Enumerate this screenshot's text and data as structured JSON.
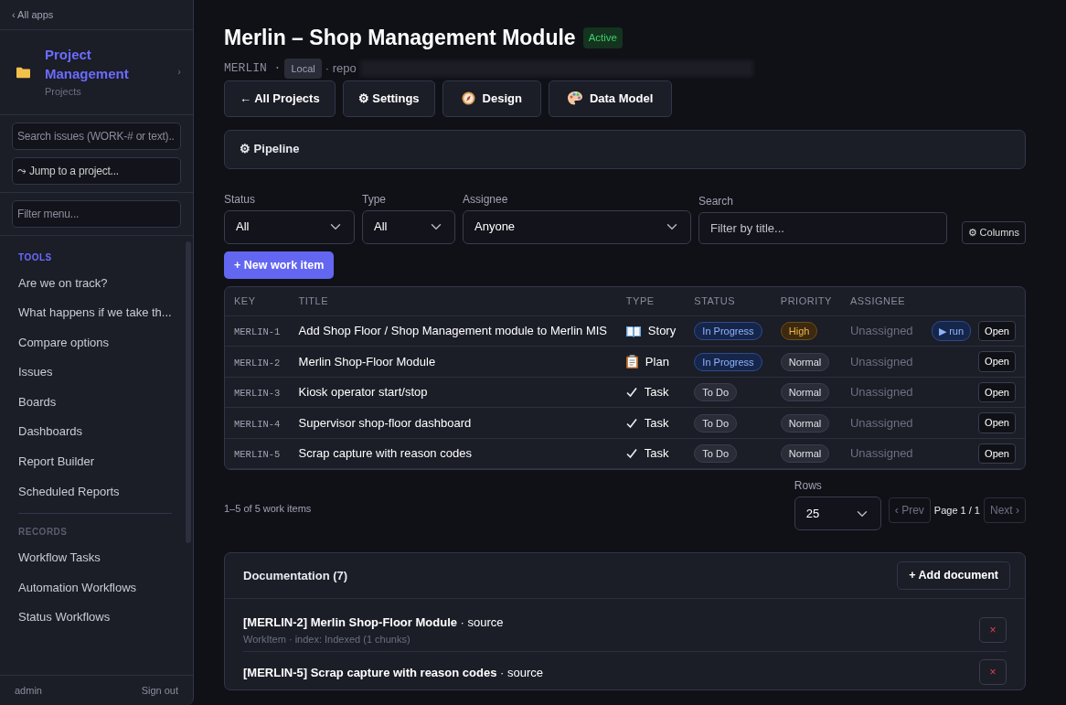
{
  "sidebar": {
    "back": "‹ All apps",
    "app_title": "Project Management",
    "app_subtitle": "Projects",
    "chevron": "›",
    "search": {
      "placeholder": "Search issues (WORK-# or text).."
    },
    "jump": "⤳ Jump to a project...",
    "filter": {
      "placeholder": "Filter menu..."
    },
    "sections": [
      {
        "title": "TOOLS",
        "selected": true,
        "items": [
          "Are we on track?",
          "What happens if we take th...",
          "Compare options",
          "Issues",
          "Boards",
          "Dashboards",
          "Report Builder",
          "Scheduled Reports"
        ]
      },
      {
        "title": "RECORDS",
        "selected": false,
        "items": [
          "Workflow Tasks",
          "Automation Workflows",
          "Status Workflows"
        ]
      }
    ],
    "user": "admin",
    "sign_out": "Sign out"
  },
  "header": {
    "title": "Merlin – Shop Management Module",
    "status": "Active",
    "key": "MERLIN ·",
    "source": "Local",
    "repo": "· repo"
  },
  "actions": [
    {
      "kind": "text",
      "label": "← All Projects"
    },
    {
      "kind": "text",
      "label": "⚙ Settings"
    },
    {
      "kind": "compass",
      "label": "Design"
    },
    {
      "kind": "palette",
      "label": "Data Model"
    }
  ],
  "pipeline": "⚙ Pipeline",
  "filters": {
    "status": {
      "label": "Status",
      "value": "All"
    },
    "type": {
      "label": "Type",
      "value": "All"
    },
    "assignee": {
      "label": "Assignee",
      "value": "Anyone"
    },
    "search": {
      "label": "Search",
      "placeholder": "Filter by title..."
    },
    "columns_button": "⚙ Columns"
  },
  "new_button": "+ New work item",
  "table": {
    "columns": [
      "KEY",
      "TITLE",
      "TYPE",
      "STATUS",
      "PRIORITY",
      "ASSIGNEE"
    ],
    "rows": [
      {
        "key": "MERLIN-1",
        "title": "Add Shop Floor / Shop Management module to Merlin MIS",
        "kind": "story",
        "type": "Story",
        "status": {
          "text": "In Progress",
          "kind": "progress"
        },
        "priority": {
          "text": "High",
          "kind": "high"
        },
        "assignee": "Unassigned",
        "run": "▶ run",
        "open": "Open"
      },
      {
        "key": "MERLIN-2",
        "title": "Merlin Shop-Floor Module",
        "kind": "plan",
        "type": "Plan",
        "status": {
          "text": "In Progress",
          "kind": "progress"
        },
        "priority": {
          "text": "Normal",
          "kind": "normal"
        },
        "assignee": "Unassigned",
        "open": "Open"
      },
      {
        "key": "MERLIN-3",
        "title": "Kiosk operator start/stop",
        "kind": "task",
        "type": "Task",
        "status": {
          "text": "To Do",
          "kind": "todo"
        },
        "priority": {
          "text": "Normal",
          "kind": "normal"
        },
        "assignee": "Unassigned",
        "open": "Open"
      },
      {
        "key": "MERLIN-4",
        "title": "Supervisor shop-floor dashboard",
        "kind": "task",
        "type": "Task",
        "status": {
          "text": "To Do",
          "kind": "todo"
        },
        "priority": {
          "text": "Normal",
          "kind": "normal"
        },
        "assignee": "Unassigned",
        "open": "Open"
      },
      {
        "key": "MERLIN-5",
        "title": "Scrap capture with reason codes",
        "kind": "task",
        "type": "Task",
        "status": {
          "text": "To Do",
          "kind": "todo"
        },
        "priority": {
          "text": "Normal",
          "kind": "normal"
        },
        "assignee": "Unassigned",
        "open": "Open"
      }
    ]
  },
  "pager": {
    "summary": "1–5 of 5 work items",
    "rows_label": "Rows",
    "rows_value": "25",
    "prev": "‹ Prev",
    "page": "Page 1 / 1",
    "next": "Next ›"
  },
  "documentation": {
    "title": "Documentation (7)",
    "add_button": "+ Add document",
    "delete": "×",
    "items": [
      {
        "title": "**[MERLIN-2] Merlin Shop-Floor Module** · source",
        "meta": "WorkItem · index: Indexed (1 chunks)"
      },
      {
        "title": "**[MERLIN-5] Scrap capture with reason codes** · source"
      }
    ]
  }
}
